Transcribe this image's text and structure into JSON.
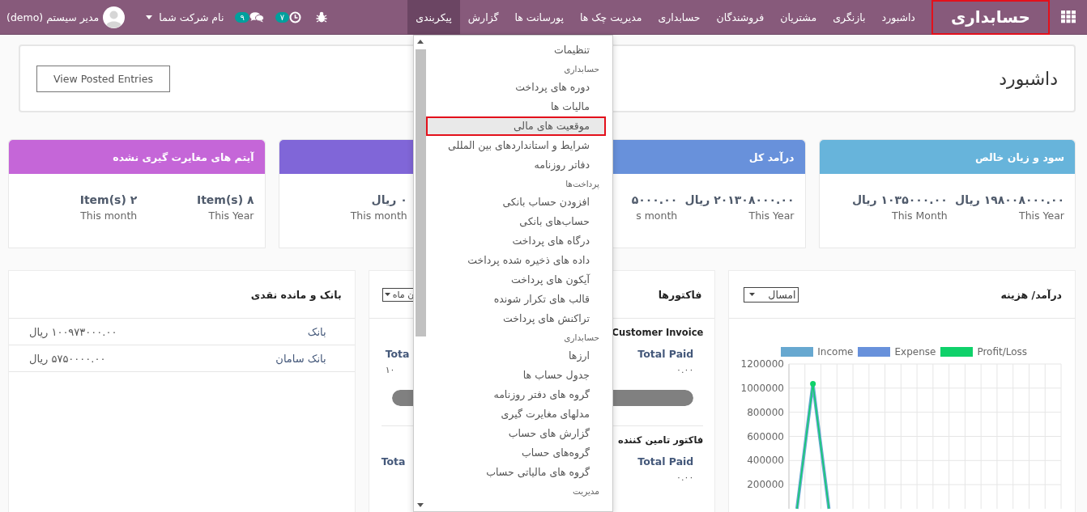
{
  "navbar": {
    "brand": "حسابداری",
    "menu": [
      {
        "label": "داشبورد",
        "selected": false
      },
      {
        "label": "بازنگری",
        "selected": false
      },
      {
        "label": "مشتریان",
        "selected": false
      },
      {
        "label": "فروشندگان",
        "selected": false
      },
      {
        "label": "حسابداری",
        "selected": false
      },
      {
        "label": "مدیریت چک ها",
        "selected": false
      },
      {
        "label": "پورسانت ها",
        "selected": false
      },
      {
        "label": "گزارش",
        "selected": false
      },
      {
        "label": "پیکربندی",
        "selected": true
      }
    ],
    "activity_count": "۷",
    "message_count": "۹",
    "company": "نام شرکت شما",
    "user": "مدیر سیستم (demo)"
  },
  "dashboard": {
    "title": "داشبورد",
    "button": "View Posted Entries"
  },
  "kpi_cards": [
    {
      "title": "سود و زیان خالص",
      "color": "#67b4db",
      "stats": [
        {
          "value": "۱۹۸۰۰۸۰۰۰.۰۰ ریال",
          "label": "This Year"
        },
        {
          "value": "۱۰۳۵۰۰۰.۰۰ ریال",
          "label": "This Month"
        }
      ]
    },
    {
      "title": "درآمد کل",
      "color": "#6891db",
      "stats": [
        {
          "value": "۲۰۱۳۰۸۰۰۰.۰۰ ریال",
          "label": "This Year"
        },
        {
          "value": "۵۰۰۰.۰۰",
          "label": "s month"
        }
      ]
    },
    {
      "color": "#8066d8",
      "stats": [
        {
          "value": "۰ ریال",
          "label": "This month"
        }
      ]
    },
    {
      "title": "آیتم های مغایرت گیری نشده",
      "color": "#c566d8",
      "stats": [
        {
          "value": "۸ Item(s)",
          "label": "This Year"
        },
        {
          "value": "۲ Item(s)",
          "label": "This month"
        }
      ]
    }
  ],
  "income_expense": {
    "title": "درآمد/ هزینه",
    "period": "امسال",
    "chart_data": {
      "type": "line",
      "grid": true,
      "legend": true,
      "ylim": [
        0,
        1200000
      ],
      "yticks": [
        200000,
        400000,
        600000,
        800000,
        1000000,
        1200000
      ],
      "series": [
        {
          "name": "Income",
          "color": "#67a8d0",
          "values": [
            0,
            1035000,
            0,
            null,
            null,
            null,
            null,
            null,
            null,
            null,
            null,
            null,
            null,
            null,
            null,
            null,
            null
          ]
        },
        {
          "name": "Expense",
          "color": "#6891db",
          "values": [
            null,
            null,
            null,
            null,
            null,
            null,
            null,
            null,
            null,
            null,
            null,
            null,
            null,
            null,
            null,
            null,
            null
          ]
        },
        {
          "name": "Profit/Loss",
          "color": "#0fd16a",
          "values": [
            0,
            1035000,
            0,
            null,
            null,
            null,
            null,
            null,
            null,
            null,
            null,
            null,
            null,
            null,
            null,
            null,
            null
          ]
        }
      ]
    }
  },
  "invoices": {
    "title": "فاکتورها",
    "period": "ن ماه",
    "sections": [
      {
        "title": "Customer Invoice",
        "paid_label": "Total Paid",
        "paid_value": "۰.۰۰",
        "other_label": "Tota",
        "other_value": "۱۰",
        "level": 1
      },
      {
        "title": "فاکتور تامین کننده",
        "paid_label": "Total Paid",
        "paid_value": "۰.۰۰",
        "other_label": "Tota"
      }
    ]
  },
  "bank": {
    "title": "بانک و مانده نقدی",
    "rows": [
      {
        "name": "بانک",
        "amount": "۱۰۰۹۷۳۰۰۰.۰۰ ریال"
      },
      {
        "name": "بانک سامان",
        "amount": "۵۷۵۰۰۰۰.۰۰ ریال"
      }
    ]
  },
  "config_menu": {
    "items": [
      {
        "kind": "item",
        "label": "تنظیمات",
        "selected": false
      },
      {
        "kind": "header",
        "label": "حسابداری",
        "selected": false
      },
      {
        "kind": "item",
        "label": "دوره های پرداخت",
        "selected": false
      },
      {
        "kind": "item",
        "label": "مالیات ها",
        "selected": false
      },
      {
        "kind": "item",
        "label": "موقعیت های مالی",
        "selected": true
      },
      {
        "kind": "item",
        "label": "شرایط و استانداردهای بین المللی",
        "selected": false
      },
      {
        "kind": "item",
        "label": "دفاتر روزنامه",
        "selected": false
      },
      {
        "kind": "header",
        "label": "پرداخت‌ها",
        "selected": false
      },
      {
        "kind": "item",
        "label": "افزودن حساب بانکی",
        "selected": false
      },
      {
        "kind": "item",
        "label": "حساب‌های بانکی",
        "selected": false
      },
      {
        "kind": "item",
        "label": "درگاه های پرداخت",
        "selected": false
      },
      {
        "kind": "item",
        "label": "داده های ذخیره شده پرداخت",
        "selected": false
      },
      {
        "kind": "item",
        "label": "آیکون های پرداخت",
        "selected": false
      },
      {
        "kind": "item",
        "label": "قالب های تکرار شونده",
        "selected": false
      },
      {
        "kind": "item",
        "label": "تراکنش های پرداخت",
        "selected": false
      },
      {
        "kind": "header",
        "label": "حسابداری",
        "selected": false
      },
      {
        "kind": "item",
        "label": "ارزها",
        "selected": false
      },
      {
        "kind": "item",
        "label": "جدول حساب ها",
        "selected": false
      },
      {
        "kind": "item",
        "label": "گروه های دفتر روزنامه",
        "selected": false
      },
      {
        "kind": "item",
        "label": "مدلهای مغایرت گیری",
        "selected": false
      },
      {
        "kind": "item",
        "label": "گزارش های حساب",
        "selected": false
      },
      {
        "kind": "item",
        "label": "گروه‌های حساب",
        "selected": false
      },
      {
        "kind": "item",
        "label": "گروه های مالیاتی حساب",
        "selected": false
      },
      {
        "kind": "header",
        "label": "مدیریت",
        "selected": false
      }
    ]
  }
}
